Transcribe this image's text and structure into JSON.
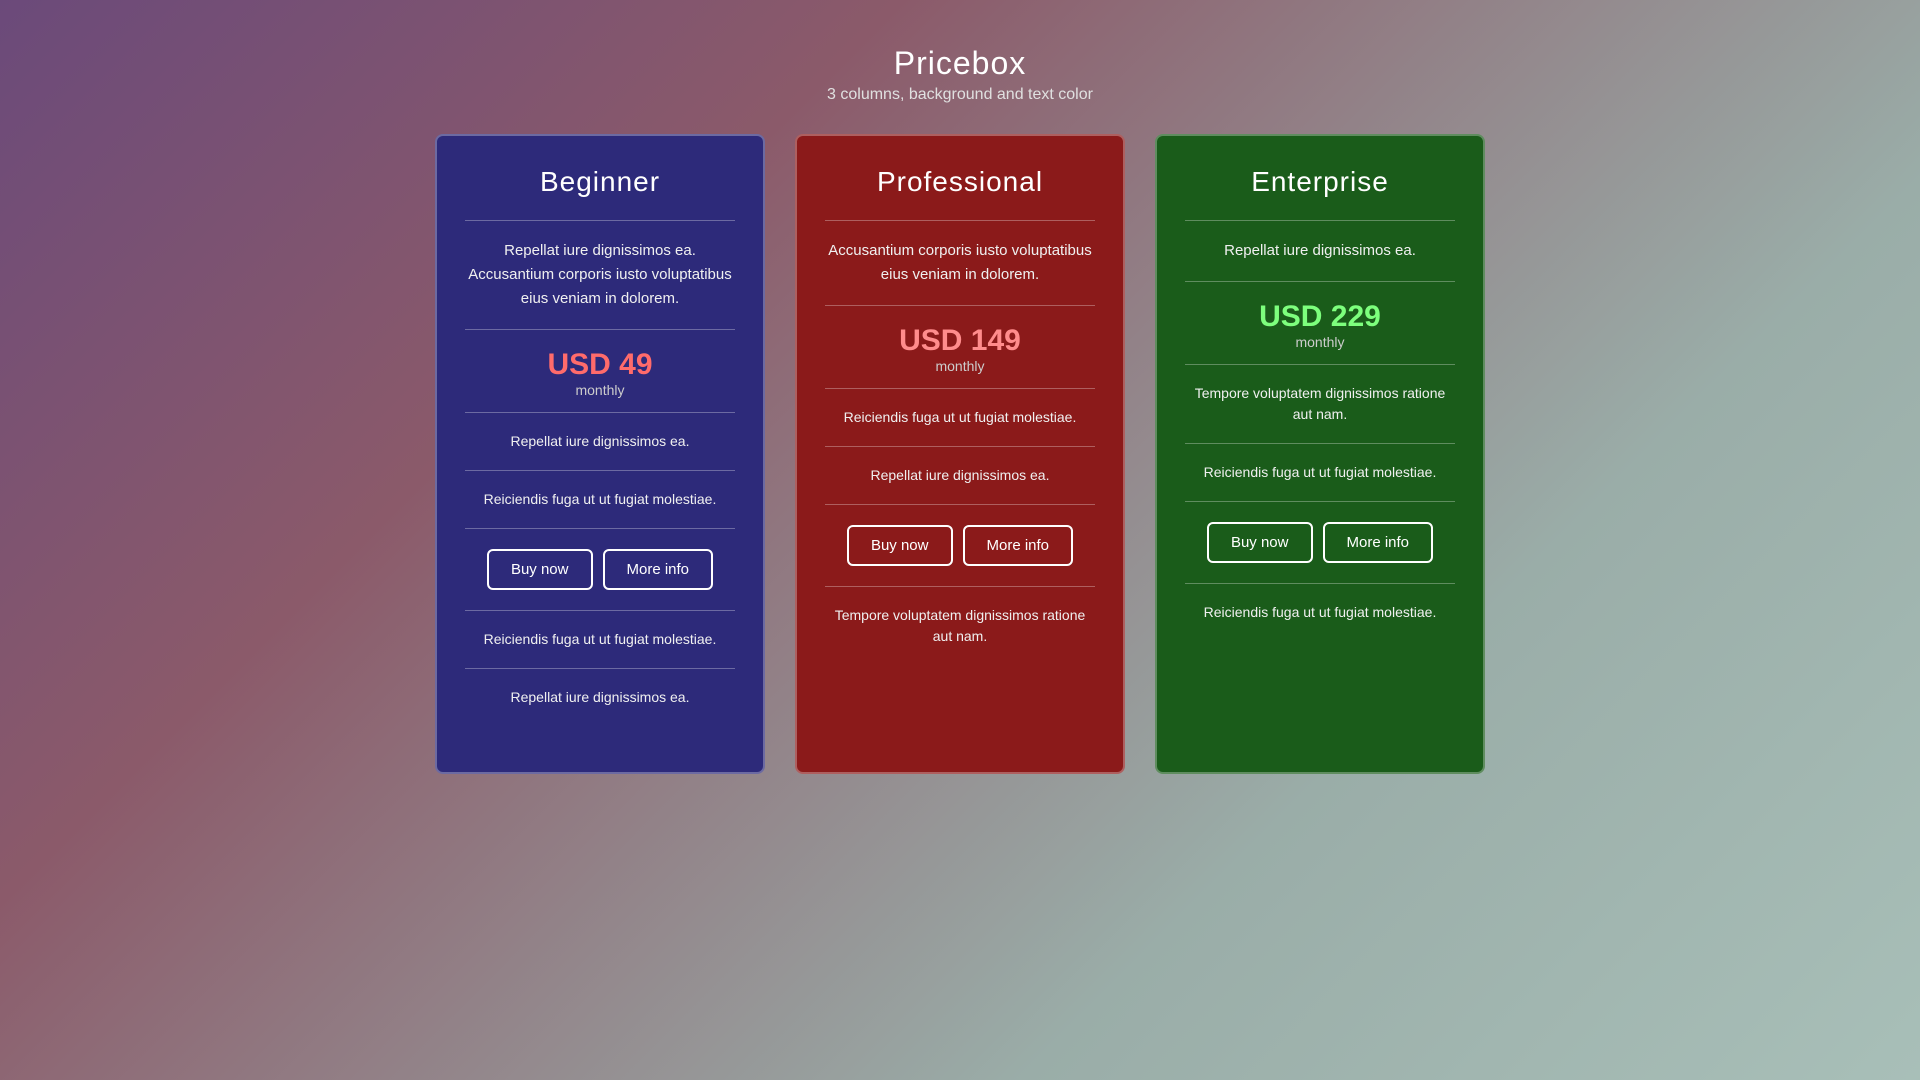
{
  "header": {
    "title": "Pricebox",
    "subtitle": "3 columns, background and text color"
  },
  "cards": [
    {
      "id": "beginner",
      "title": "Beginner",
      "description": "Repellat iure dignissimos ea. Accusantium corporis iusto voluptatibus eius veniam in dolorem.",
      "price": "USD 49",
      "period": "monthly",
      "features": [
        "Repellat iure dignissimos ea.",
        "Reiciendis fuga ut ut fugiat molestiae.",
        "Reiciendis fuga ut ut fugiat molestiae.",
        "Repellat iure dignissimos ea."
      ],
      "btn_buy": "Buy now",
      "btn_info": "More info"
    },
    {
      "id": "professional",
      "title": "Professional",
      "description": "Accusantium corporis iusto voluptatibus eius veniam in dolorem.",
      "price": "USD 149",
      "period": "monthly",
      "features": [
        "Reiciendis fuga ut ut fugiat molestiae.",
        "Repellat iure dignissimos ea.",
        "Tempore voluptatem dignissimos ratione aut nam."
      ],
      "btn_buy": "Buy now",
      "btn_info": "More info"
    },
    {
      "id": "enterprise",
      "title": "Enterprise",
      "description": "Repellat iure dignissimos ea.",
      "price": "USD 229",
      "period": "monthly",
      "features": [
        "Tempore voluptatem dignissimos ratione aut nam.",
        "Reiciendis fuga ut ut fugiat molestiae.",
        "Reiciendis fuga ut ut fugiat molestiae."
      ],
      "btn_buy": "Buy now",
      "btn_info": "More info"
    }
  ]
}
